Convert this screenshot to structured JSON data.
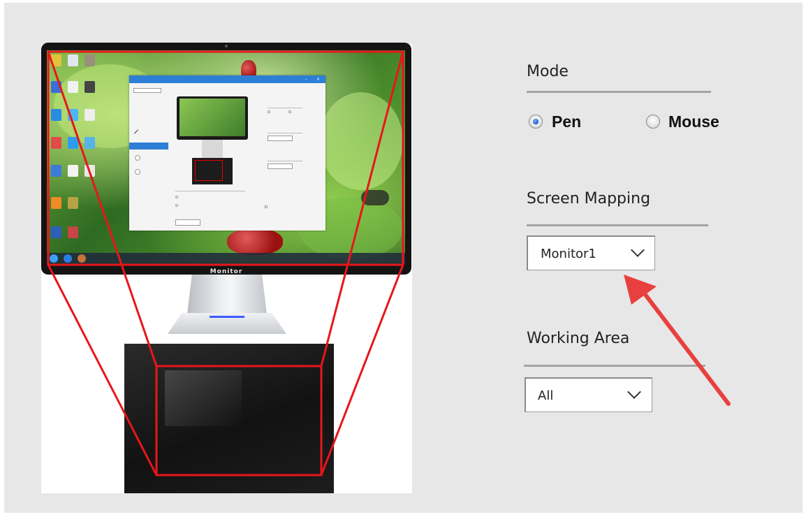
{
  "illustration": {
    "monitor_brand": "Monitor",
    "mapping_color": "#e8161b"
  },
  "settings": {
    "mode": {
      "title": "Mode",
      "options": [
        {
          "label": "Pen",
          "checked": true
        },
        {
          "label": "Mouse",
          "checked": false
        }
      ]
    },
    "screen_mapping": {
      "title": "Screen Mapping",
      "selected": "Monitor1"
    },
    "working_area": {
      "title": "Working Area",
      "selected": "All"
    }
  },
  "annotation": {
    "arrow_color": "#e8403f"
  }
}
